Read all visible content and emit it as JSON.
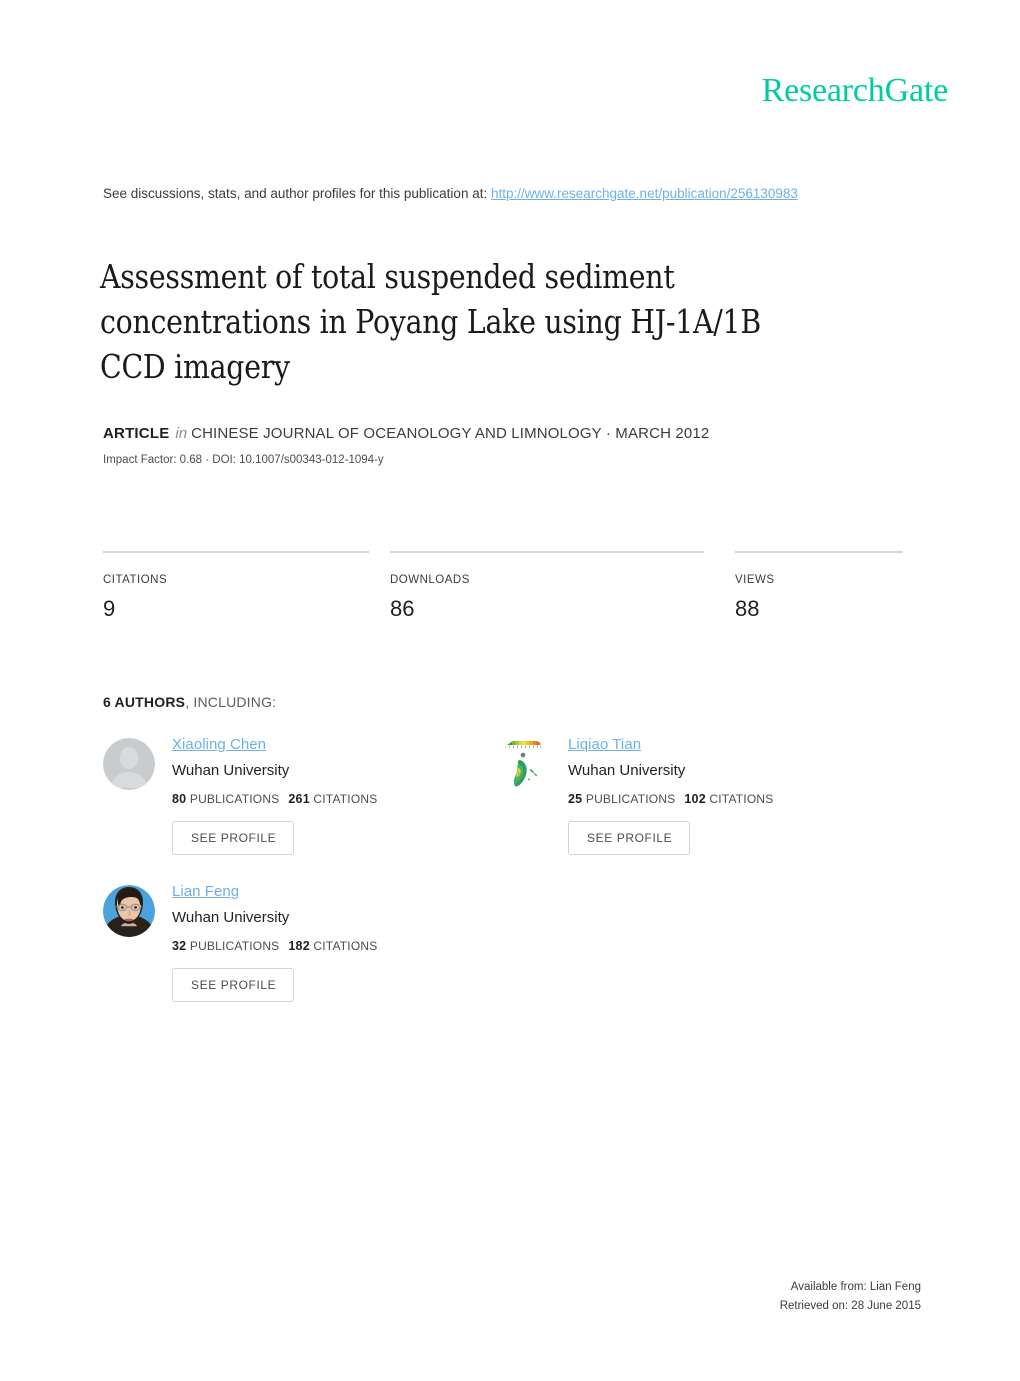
{
  "brand": {
    "logo_text": "ResearchGate",
    "logo_color": "#00cca3",
    "link_color": "#6cb1ea"
  },
  "discussion": {
    "prefix": "See discussions, stats, and author profiles for this publication at:",
    "url": "http://www.researchgate.net/publication/256130983"
  },
  "publication": {
    "title": "Assessment of total suspended sediment concentrations in Poyang Lake using HJ-1A/1B CCD imagery",
    "type_label": "ARTICLE",
    "in_label": "in",
    "journal": "CHINESE JOURNAL OF OCEANOLOGY AND LIMNOLOGY · MARCH 2012",
    "impact_line": "Impact Factor: 0.68 · DOI: 10.1007/s00343-012-1094-y"
  },
  "stats": [
    {
      "label": "CITATIONS",
      "value": "9"
    },
    {
      "label": "DOWNLOADS",
      "value": "86"
    },
    {
      "label": "VIEWS",
      "value": "88"
    }
  ],
  "authors_section": {
    "count_label": "6 AUTHORS",
    "including_label": ", INCLUDING:",
    "see_profile_label": "SEE PROFILE",
    "publications_label": "PUBLICATIONS",
    "citations_label": "CITATIONS"
  },
  "authors": [
    {
      "name": "Xiaoling Chen",
      "institution": "Wuhan University",
      "publications": "80",
      "citations": "261",
      "avatar_type": "placeholder-person-icon"
    },
    {
      "name": "Liqiao Tian",
      "institution": "Wuhan University",
      "publications": "25",
      "citations": "102",
      "avatar_type": "lake-map-thumbnail-icon"
    },
    {
      "name": "Lian Feng",
      "institution": "Wuhan University",
      "publications": "32",
      "citations": "182",
      "avatar_type": "portrait-photo-icon"
    }
  ],
  "footer": {
    "available_from": "Available from: Lian Feng",
    "retrieved_on": "Retrieved on: 28 June 2015"
  }
}
